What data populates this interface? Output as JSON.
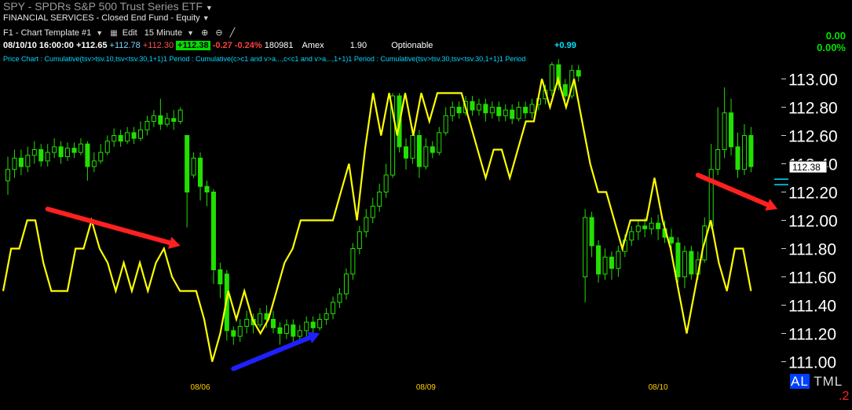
{
  "header": {
    "symbol": "SPY",
    "description": "SPDRs S&P 500 Trust Series ETF",
    "sector": "FINANCIAL SERVICES - Closed End Fund - Equity",
    "template": "F1 - Chart Template #1",
    "edit_label": "Edit",
    "interval": "15 Minute"
  },
  "quote": {
    "datetime": "08/10/10 16:00:00",
    "open": "+112.65",
    "high": "+112.78",
    "low": "+112.30",
    "last": "+112.38",
    "change": "-0.27",
    "change_pct": "-0.24%",
    "volume": "180981",
    "exchange": "Amex",
    "value": "1.90",
    "optionable": "Optionable",
    "delta": "+0.99",
    "right_change": "0.00",
    "right_pct": "0.00%"
  },
  "study_line": "Price Chart : Cumulative(tsv>tsv.10,tsv<tsv.30,1+1)1 Period : Cumulative(c>c1 and v>a...,c<c1 and v>a...,1+1)1 Period : Cumulative(tsv>tsv.30,tsv<tsv.30,1+1)1 Period",
  "footer": {
    "al": "AL",
    "tml": "TML",
    "num": ".2"
  },
  "colors": {
    "up": "#22e000",
    "down": "#00a000",
    "wick": "#22dd00",
    "indicator": "#ffff00",
    "arrow_red": "#ff2020",
    "arrow_blue": "#2020ff",
    "current_price": "#00ddff",
    "background": "#000000"
  },
  "chart_data": {
    "type": "candlestick",
    "ylim": [
      110.9,
      113.1
    ],
    "yticks": [
      "113.00",
      "112.80",
      "112.60",
      "112.40",
      "112.20",
      "112.00",
      "111.80",
      "111.60",
      "111.40",
      "111.20",
      "111.00"
    ],
    "ytick_values": [
      113.0,
      112.8,
      112.6,
      112.4,
      112.2,
      112.0,
      111.8,
      111.6,
      111.4,
      111.2,
      111.0
    ],
    "current_price_label": "112.38",
    "current_price": 112.38,
    "xtick_labels": [
      "08/06",
      "08/09",
      "08/10"
    ],
    "xtick_bars": [
      29,
      63,
      98
    ],
    "candles": [
      [
        112.28,
        112.36,
        112.18,
        112.45
      ],
      [
        112.36,
        112.44,
        112.3,
        112.5
      ],
      [
        112.44,
        112.38,
        112.32,
        112.5
      ],
      [
        112.38,
        112.46,
        112.34,
        112.52
      ],
      [
        112.46,
        112.5,
        112.4,
        112.56
      ],
      [
        112.5,
        112.42,
        112.38,
        112.54
      ],
      [
        112.42,
        112.48,
        112.38,
        112.54
      ],
      [
        112.48,
        112.52,
        112.44,
        112.58
      ],
      [
        112.52,
        112.45,
        112.4,
        112.56
      ],
      [
        112.45,
        112.51,
        112.42,
        112.55
      ],
      [
        112.51,
        112.48,
        112.44,
        112.55
      ],
      [
        112.48,
        112.54,
        112.46,
        112.58
      ],
      [
        112.54,
        112.38,
        112.28,
        112.56
      ],
      [
        112.38,
        112.42,
        112.34,
        112.48
      ],
      [
        112.42,
        112.48,
        112.4,
        112.54
      ],
      [
        112.48,
        112.56,
        112.46,
        112.6
      ],
      [
        112.56,
        112.6,
        112.52,
        112.65
      ],
      [
        112.6,
        112.56,
        112.52,
        112.64
      ],
      [
        112.56,
        112.62,
        112.54,
        112.66
      ],
      [
        112.62,
        112.58,
        112.54,
        112.66
      ],
      [
        112.58,
        112.64,
        112.56,
        112.7
      ],
      [
        112.64,
        112.7,
        112.6,
        112.74
      ],
      [
        112.7,
        112.74,
        112.66,
        112.78
      ],
      [
        112.74,
        112.68,
        112.64,
        112.86
      ],
      [
        112.68,
        112.72,
        112.66,
        112.76
      ],
      [
        112.72,
        112.7,
        112.64,
        112.78
      ],
      [
        112.7,
        112.78,
        112.68,
        112.8
      ],
      [
        112.6,
        112.2,
        111.95,
        112.3
      ],
      [
        112.32,
        112.44,
        112.3,
        112.48
      ],
      [
        112.44,
        112.24,
        112.14,
        112.48
      ],
      [
        112.24,
        112.2,
        112.1,
        112.28
      ],
      [
        112.2,
        111.65,
        111.55,
        112.22
      ],
      [
        111.65,
        111.55,
        111.45,
        111.7
      ],
      [
        111.62,
        111.22,
        111.15,
        111.65
      ],
      [
        111.22,
        111.18,
        111.12,
        111.25
      ],
      [
        111.18,
        111.25,
        111.14,
        111.3
      ],
      [
        111.25,
        111.3,
        111.2,
        111.36
      ],
      [
        111.3,
        111.26,
        111.2,
        111.34
      ],
      [
        111.26,
        111.34,
        111.24,
        111.38
      ],
      [
        111.34,
        111.3,
        111.24,
        111.4
      ],
      [
        111.3,
        111.24,
        111.2,
        111.36
      ],
      [
        111.24,
        111.2,
        111.12,
        111.28
      ],
      [
        111.2,
        111.26,
        111.16,
        111.3
      ],
      [
        111.26,
        111.18,
        111.14,
        111.3
      ],
      [
        111.18,
        111.22,
        111.14,
        111.26
      ],
      [
        111.22,
        111.28,
        111.18,
        111.32
      ],
      [
        111.28,
        111.24,
        111.2,
        111.32
      ],
      [
        111.24,
        111.3,
        111.22,
        111.34
      ],
      [
        111.3,
        111.34,
        111.26,
        111.38
      ],
      [
        111.34,
        111.42,
        111.3,
        111.46
      ],
      [
        111.42,
        111.48,
        111.38,
        111.52
      ],
      [
        111.48,
        111.62,
        111.44,
        111.66
      ],
      [
        111.62,
        111.8,
        111.58,
        111.84
      ],
      [
        111.8,
        111.92,
        111.76,
        111.96
      ],
      [
        111.92,
        112.02,
        111.88,
        112.08
      ],
      [
        112.02,
        112.1,
        111.98,
        112.16
      ],
      [
        112.1,
        112.2,
        112.06,
        112.26
      ],
      [
        112.2,
        112.32,
        112.16,
        112.4
      ],
      [
        112.32,
        112.88,
        112.3,
        112.9
      ],
      [
        112.88,
        112.52,
        112.48,
        112.9
      ],
      [
        112.52,
        112.44,
        112.36,
        112.58
      ],
      [
        112.44,
        112.6,
        112.4,
        112.66
      ],
      [
        112.6,
        112.38,
        112.3,
        112.64
      ],
      [
        112.38,
        112.52,
        112.36,
        112.58
      ],
      [
        112.52,
        112.48,
        112.44,
        112.56
      ],
      [
        112.48,
        112.62,
        112.46,
        112.66
      ],
      [
        112.62,
        112.74,
        112.6,
        112.8
      ],
      [
        112.74,
        112.8,
        112.7,
        112.84
      ],
      [
        112.8,
        112.76,
        112.72,
        112.84
      ],
      [
        112.76,
        112.84,
        112.74,
        112.88
      ],
      [
        112.84,
        112.78,
        112.74,
        112.88
      ],
      [
        112.78,
        112.82,
        112.74,
        112.86
      ],
      [
        112.82,
        112.76,
        112.7,
        112.86
      ],
      [
        112.76,
        112.8,
        112.72,
        112.84
      ],
      [
        112.8,
        112.74,
        112.7,
        112.84
      ],
      [
        112.74,
        112.78,
        112.7,
        112.82
      ],
      [
        112.78,
        112.72,
        112.68,
        112.82
      ],
      [
        112.72,
        112.8,
        112.7,
        112.84
      ],
      [
        112.8,
        112.76,
        112.72,
        112.84
      ],
      [
        112.76,
        112.82,
        112.72,
        112.86
      ],
      [
        112.82,
        112.86,
        112.78,
        112.9
      ],
      [
        112.86,
        112.92,
        112.82,
        112.96
      ],
      [
        112.92,
        113.1,
        112.88,
        113.12
      ],
      [
        113.1,
        112.96,
        112.92,
        113.14
      ],
      [
        112.96,
        112.88,
        112.84,
        113.0
      ],
      [
        112.88,
        113.06,
        112.86,
        113.1
      ],
      [
        113.06,
        113.02,
        112.98,
        113.1
      ],
      [
        111.6,
        112.02,
        111.42,
        112.08
      ],
      [
        112.02,
        111.82,
        111.74,
        112.06
      ],
      [
        111.82,
        111.62,
        111.56,
        111.86
      ],
      [
        111.62,
        111.74,
        111.58,
        111.8
      ],
      [
        111.74,
        111.66,
        111.58,
        111.78
      ],
      [
        111.66,
        111.78,
        111.6,
        111.82
      ],
      [
        111.78,
        111.86,
        111.74,
        111.9
      ],
      [
        111.86,
        111.92,
        111.82,
        111.96
      ],
      [
        111.92,
        111.96,
        111.86,
        112.0
      ],
      [
        111.96,
        111.94,
        111.88,
        112.02
      ],
      [
        111.94,
        111.98,
        111.9,
        112.02
      ],
      [
        111.98,
        111.94,
        111.86,
        112.04
      ],
      [
        111.94,
        111.88,
        111.84,
        112.0
      ],
      [
        111.88,
        111.84,
        111.76,
        111.94
      ],
      [
        111.84,
        111.6,
        111.56,
        111.88
      ],
      [
        111.6,
        111.78,
        111.52,
        111.82
      ],
      [
        111.78,
        111.62,
        111.58,
        111.82
      ],
      [
        111.62,
        111.72,
        111.58,
        111.78
      ],
      [
        111.72,
        111.96,
        111.7,
        112.02
      ],
      [
        111.96,
        112.36,
        111.94,
        112.54
      ],
      [
        112.36,
        112.5,
        112.32,
        112.8
      ],
      [
        112.5,
        112.76,
        112.44,
        112.94
      ],
      [
        112.76,
        112.52,
        112.46,
        112.86
      ],
      [
        112.52,
        112.36,
        112.3,
        112.62
      ],
      [
        112.36,
        112.6,
        112.32,
        112.68
      ],
      [
        112.6,
        112.38,
        112.34,
        112.66
      ]
    ],
    "indicator_line": [
      111.5,
      111.8,
      111.8,
      112.0,
      112.0,
      111.7,
      111.5,
      111.5,
      111.5,
      111.8,
      111.8,
      112.0,
      111.8,
      111.7,
      111.5,
      111.7,
      111.5,
      111.7,
      111.5,
      111.7,
      111.8,
      111.6,
      111.5,
      111.5,
      111.5,
      111.3,
      111.0,
      111.2,
      111.5,
      111.3,
      111.5,
      111.3,
      111.2,
      111.3,
      111.5,
      111.7,
      111.8,
      112.0,
      112.0,
      112.0,
      112.0,
      112.0,
      112.2,
      112.4,
      112.0,
      112.5,
      112.9,
      112.6,
      112.9,
      112.6,
      112.9,
      112.6,
      112.9,
      112.7,
      112.9,
      112.9,
      112.9,
      112.9,
      112.7,
      112.5,
      112.3,
      112.5,
      112.5,
      112.3,
      112.5,
      112.7,
      112.7,
      113.0,
      112.8,
      113.0,
      112.8,
      113.0,
      112.7,
      112.4,
      112.2,
      112.2,
      112.0,
      111.8,
      112.0,
      112.0,
      112.0,
      112.3,
      112.0,
      111.8,
      111.5,
      111.2,
      111.5,
      111.8,
      112.0,
      111.7,
      111.5,
      111.8,
      111.8,
      111.5
    ],
    "annotations": [
      {
        "type": "arrow",
        "color": "red",
        "from": [
          6,
          112.08
        ],
        "to": [
          26,
          111.82
        ]
      },
      {
        "type": "arrow",
        "color": "blue",
        "from": [
          34,
          110.95
        ],
        "to": [
          47,
          111.2
        ]
      },
      {
        "type": "arrow",
        "color": "red",
        "from": [
          104,
          112.32
        ],
        "to": [
          116,
          112.08
        ]
      }
    ]
  }
}
